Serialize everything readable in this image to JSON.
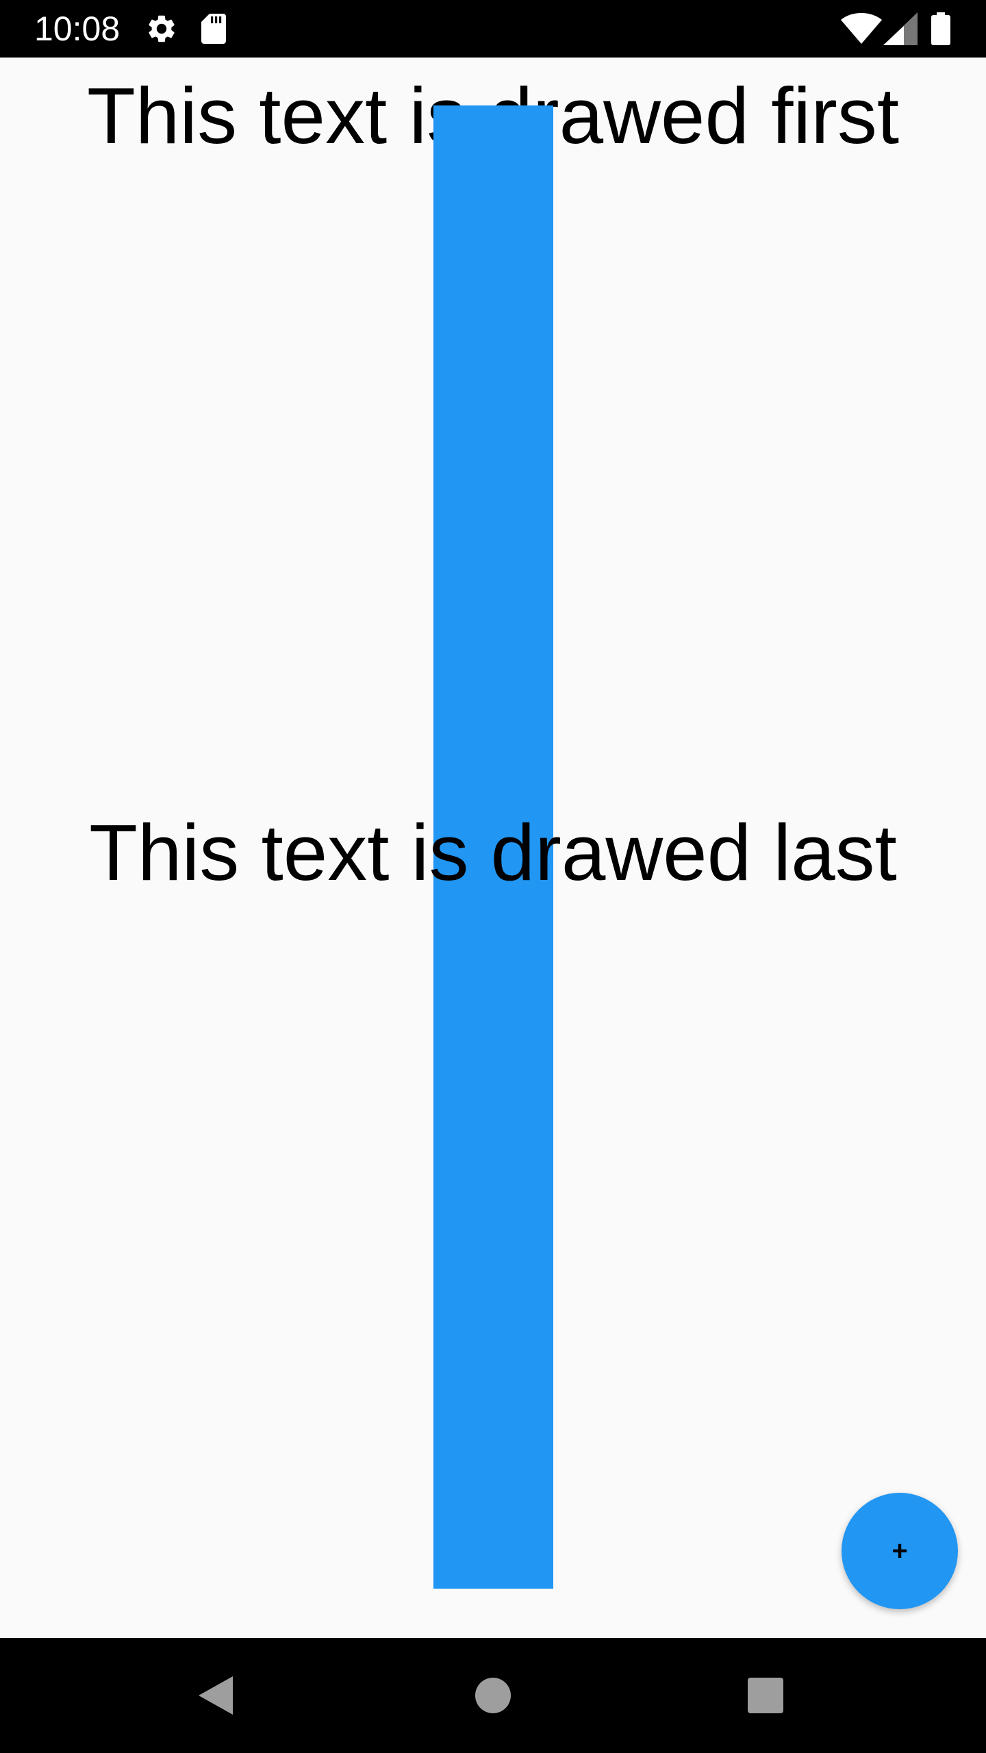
{
  "status_bar": {
    "time": "10:08",
    "icons": [
      "settings-icon",
      "sd-card-icon",
      "wifi-icon",
      "cell-signal-icon",
      "battery-icon"
    ]
  },
  "main": {
    "text_first": "This text is drawed first",
    "text_last": "This text is drawed last",
    "bar_color": "#2196f3"
  },
  "fab": {
    "label": "+",
    "color": "#2196f3"
  },
  "nav_bar": {
    "buttons": [
      "back-icon",
      "home-icon",
      "recents-icon"
    ]
  }
}
